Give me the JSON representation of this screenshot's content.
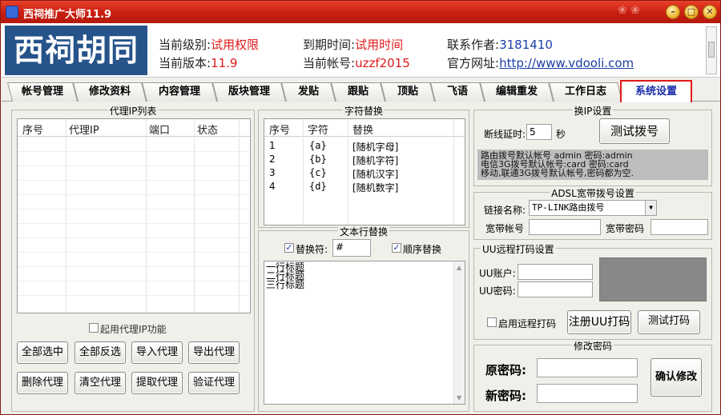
{
  "window": {
    "title": "西祠推广大师11.9"
  },
  "header": {
    "logo": "西祠胡同",
    "level_label": "当前级别:",
    "level_value": "试用权限",
    "version_label": "当前版本:",
    "version_value": "11.9",
    "expire_label": "到期时间:",
    "expire_value": "试用时间",
    "account_label": "当前帐号:",
    "account_value": "uzzf2015",
    "contact_label": "联系作者:",
    "contact_value": "3181410",
    "site_label": "官方网址:",
    "site_value": "http://www.vdooli.com"
  },
  "tabs": [
    "帐号管理",
    "修改资料",
    "内容管理",
    "版块管理",
    "发贴",
    "跟贴",
    "顶贴",
    "飞语",
    "编辑重发",
    "工作日志",
    "系统设置"
  ],
  "proxy": {
    "title": "代理IP列表",
    "columns": [
      "序号",
      "代理IP",
      "端口",
      "状态"
    ],
    "enable_label": "起用代理IP功能",
    "buttons": [
      "全部选中",
      "全部反选",
      "导入代理",
      "导出代理",
      "删除代理",
      "清空代理",
      "提取代理",
      "验证代理"
    ]
  },
  "replace": {
    "title": "字符替换",
    "columns": [
      "序号",
      "字符",
      "替换"
    ],
    "rows": [
      {
        "no": "1",
        "char": "{a}",
        "rep": "[随机字母]"
      },
      {
        "no": "2",
        "char": "{b}",
        "rep": "[随机字符]"
      },
      {
        "no": "3",
        "char": "{c}",
        "rep": "[随机汉字]"
      },
      {
        "no": "4",
        "char": "{d}",
        "rep": "[随机数字]"
      }
    ]
  },
  "textline": {
    "title": "文本行替换",
    "replace_label": "替换符:",
    "replace_value": "#",
    "order_label": "顺序替换",
    "lines": [
      "一行标题",
      "二行标题",
      "三行标题"
    ]
  },
  "ipchange": {
    "title": "换IP设置",
    "delay_label": "断线延时:",
    "delay_value": "5",
    "delay_unit": "秒",
    "test_button": "测试拨号",
    "info": [
      "路由拨号默认帐号 admin 密码:admin",
      "电信3G拨号默认帐号:card 密码:card",
      "移动,联通3G拨号默认帐号,密码都为空."
    ]
  },
  "adsl": {
    "title": "ADSL宽带拨号设置",
    "link_label": "链接名称:",
    "link_value": "TP-LINK路由拨号",
    "account_label": "宽带帐号",
    "password_label": "宽带密码"
  },
  "uu": {
    "title": "UU远程打码设置",
    "account_label": "UU账户:",
    "password_label": "UU密码:",
    "enable_label": "启用远程打码",
    "register_button": "注册UU打码",
    "test_button": "测试打码"
  },
  "pwd": {
    "title": "修改密码",
    "old_label": "原密码:",
    "new_label": "新密码:",
    "confirm_button": "确认修改"
  }
}
